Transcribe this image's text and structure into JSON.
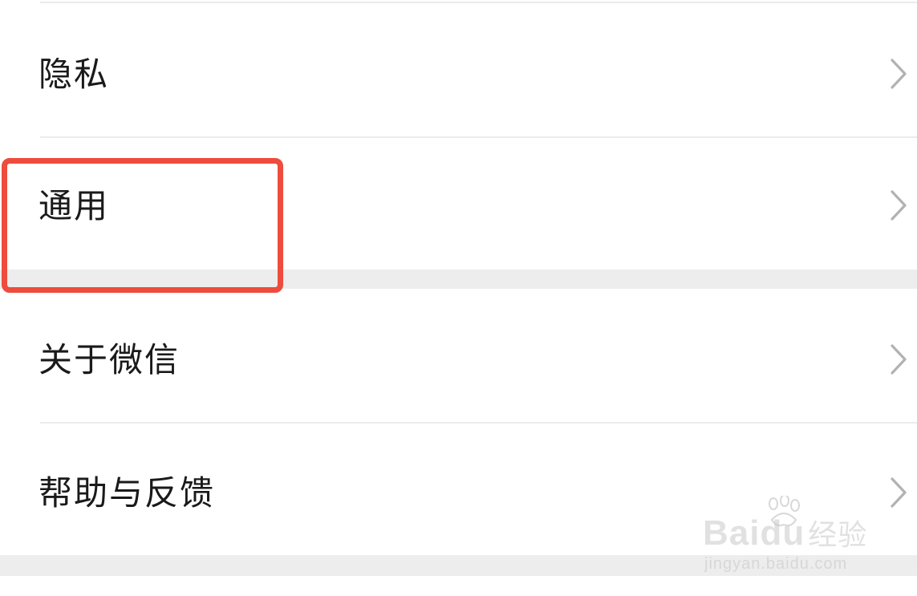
{
  "settings_list": {
    "items": [
      {
        "label": "隐私",
        "chevron": "chevron-right-icon"
      },
      {
        "label": "通用",
        "chevron": "chevron-right-icon"
      },
      {
        "label": "关于微信",
        "chevron": "chevron-right-icon"
      },
      {
        "label": "帮助与反馈",
        "chevron": "chevron-right-icon"
      }
    ]
  },
  "annotation": {
    "highlight_target": "通用",
    "highlight_color": "#ee4c3c"
  },
  "watermark": {
    "brand": "Bai",
    "brand_suffix": "du",
    "brand_cn": "经验",
    "url": "jingyan.baidu.com"
  },
  "colors": {
    "background": "#ffffff",
    "divider": "#ebebeb",
    "group_gap": "#ededed",
    "text": "#1a1a1a",
    "chevron": "#b2b2b2"
  }
}
